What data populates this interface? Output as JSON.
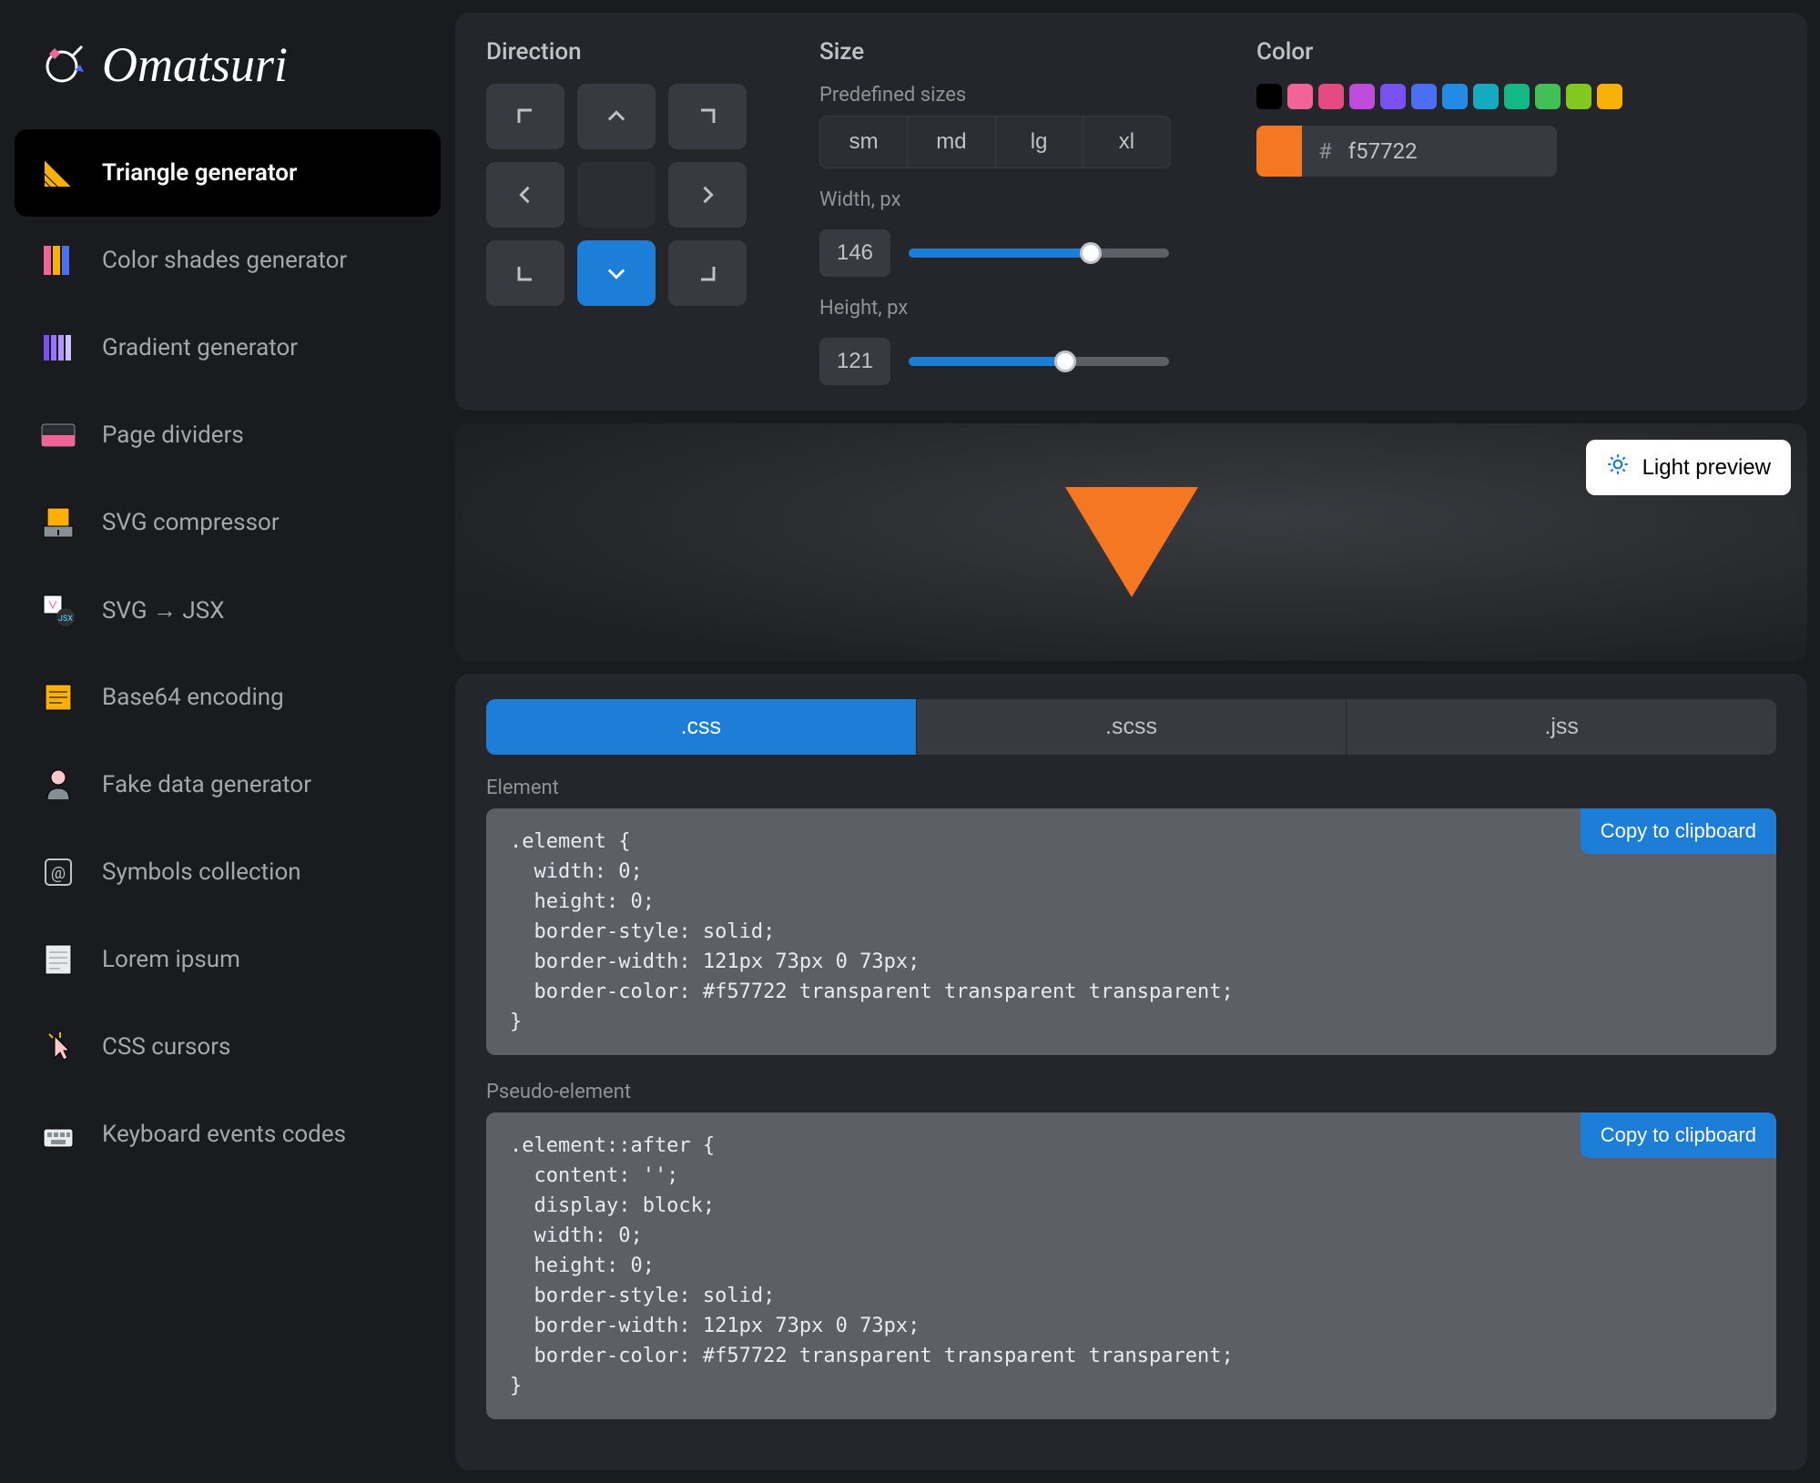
{
  "app_name": "Omatsuri",
  "sidebar": {
    "items": [
      {
        "label": "Triangle generator",
        "active": true
      },
      {
        "label": "Color shades generator"
      },
      {
        "label": "Gradient generator"
      },
      {
        "label": "Page dividers"
      },
      {
        "label": "SVG compressor"
      },
      {
        "label": "SVG → JSX"
      },
      {
        "label": "Base64 encoding"
      },
      {
        "label": "Fake data generator"
      },
      {
        "label": "Symbols collection"
      },
      {
        "label": "Lorem ipsum"
      },
      {
        "label": "CSS cursors"
      },
      {
        "label": "Keyboard events codes"
      }
    ]
  },
  "controls": {
    "direction": {
      "title": "Direction",
      "selected": "bottom"
    },
    "size": {
      "title": "Size",
      "predefined_label": "Predefined sizes",
      "presets": [
        "sm",
        "md",
        "lg",
        "xl"
      ],
      "width_label": "Width, px",
      "width_value": "146",
      "width_pct": 70,
      "height_label": "Height, px",
      "height_value": "121",
      "height_pct": 60
    },
    "color": {
      "title": "Color",
      "swatches": [
        "#000000",
        "#f06595",
        "#e64980",
        "#be4bdb",
        "#7950f2",
        "#4c6ef5",
        "#228be6",
        "#15aabf",
        "#12b886",
        "#40c057",
        "#82c91e",
        "#fab005"
      ],
      "hash": "#",
      "value": "f57722",
      "current": "#f57722"
    }
  },
  "preview": {
    "light_label": "Light preview",
    "triangle_color": "#f57722",
    "triangle_w": 146,
    "triangle_h": 121
  },
  "code": {
    "tabs": [
      ".css",
      ".scss",
      ".jss"
    ],
    "active_tab": ".css",
    "element_label": "Element",
    "pseudo_label": "Pseudo-element",
    "copy_label": "Copy to clipboard",
    "element_code": ".element {\n  width: 0;\n  height: 0;\n  border-style: solid;\n  border-width: 121px 73px 0 73px;\n  border-color: #f57722 transparent transparent transparent;\n}",
    "pseudo_code": ".element::after {\n  content: '';\n  display: block;\n  width: 0;\n  height: 0;\n  border-style: solid;\n  border-width: 121px 73px 0 73px;\n  border-color: #f57722 transparent transparent transparent;\n}"
  }
}
